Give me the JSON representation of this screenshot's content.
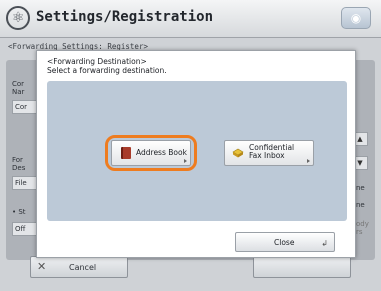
{
  "header": {
    "title": "Settings/Registration",
    "icon": "settings-menu-icon",
    "right_icon": "counter-icon"
  },
  "background": {
    "subtitle": "<Forwarding Settings: Register>",
    "rows": [
      {
        "label": "Cor\nNar"
      },
      {
        "label": "Cor"
      },
      {
        "label": "For\nDes"
      },
      {
        "label": "File"
      },
      {
        "label": "• St"
      },
      {
        "label": "Off"
      }
    ],
    "right_texts": [
      "ne",
      "ne",
      "ody\nrs"
    ],
    "cancel_label": "Cancel"
  },
  "dialog": {
    "heading": "<Forwarding Destination>",
    "instruction": "Select a forwarding destination.",
    "options": [
      {
        "label": "Address Book",
        "icon": "address-book-icon"
      },
      {
        "label_line1": "Confidential",
        "label_line2": "Fax Inbox",
        "icon": "inbox-tray-icon"
      }
    ],
    "close_label": "Close",
    "highlight_color": "#ee7c1f"
  }
}
